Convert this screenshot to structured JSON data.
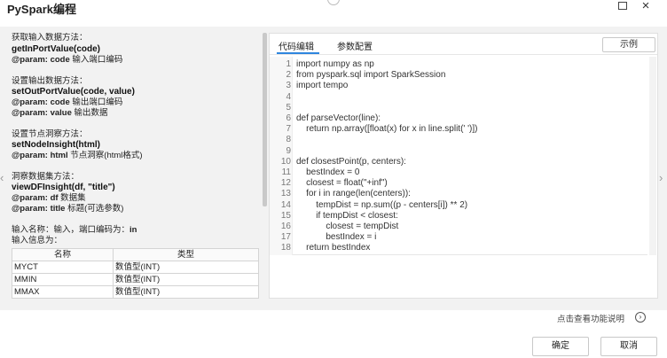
{
  "window": {
    "title": "PySpark编程",
    "minimize_icon": "square-icon",
    "close_label": "×"
  },
  "nav": {
    "left_arrow": "‹",
    "right_arrow": "›"
  },
  "help": {
    "lines": [
      {
        "kind": "text",
        "text": "获取输入数据方法："
      },
      {
        "kind": "fn",
        "text": "getInPortValue(code)"
      },
      {
        "kind": "param",
        "name": "@param: code",
        "desc": " 输入端口编码"
      },
      {
        "kind": "text",
        "text": "设置输出数据方法："
      },
      {
        "kind": "fn",
        "text": "setOutPortValue(code, value)"
      },
      {
        "kind": "param",
        "name": "@param: code",
        "desc": " 输出端口编码"
      },
      {
        "kind": "param",
        "name": "@param: value",
        "desc": " 输出数据"
      },
      {
        "kind": "text",
        "text": "设置节点洞察方法："
      },
      {
        "kind": "fn",
        "text": "setNodeInsight(html)"
      },
      {
        "kind": "param",
        "name": "@param: html",
        "desc": " 节点洞察(html格式)"
      },
      {
        "kind": "text",
        "text": "洞察数据集方法："
      },
      {
        "kind": "fn",
        "text": "viewDFInsight(df, \"title\")"
      },
      {
        "kind": "param",
        "name": "@param: df",
        "desc": " 数据集"
      },
      {
        "kind": "param",
        "name": "@param: title",
        "desc": " 标题(可选参数)"
      },
      {
        "kind": "port",
        "label": "输入名称：输入，端口编码为：",
        "code": "in"
      },
      {
        "kind": "text",
        "text": "输入信息为："
      }
    ],
    "table": {
      "headers": [
        "名称",
        "类型"
      ],
      "rows": [
        [
          "MYCT",
          "数值型(INT)"
        ],
        [
          "MMIN",
          "数值型(INT)"
        ],
        [
          "MMAX",
          "数值型(INT)"
        ]
      ]
    }
  },
  "editor": {
    "tabs": [
      "代码编辑",
      "参数配置"
    ],
    "example_label": "示例",
    "lines": [
      {
        "num": "1",
        "text": "import numpy as np"
      },
      {
        "num": "2",
        "text": "from pyspark.sql import SparkSession"
      },
      {
        "num": "3",
        "text": "import tempo"
      },
      {
        "num": "4",
        "text": ""
      },
      {
        "num": "5",
        "text": ""
      },
      {
        "num": "6",
        "text": "def parseVector(line):"
      },
      {
        "num": "7",
        "text": "    return np.array([float(x) for x in line.split(' ')])"
      },
      {
        "num": "8",
        "text": ""
      },
      {
        "num": "9",
        "text": ""
      },
      {
        "num": "10",
        "text": "def closestPoint(p, centers):"
      },
      {
        "num": "11",
        "text": "    bestIndex = 0"
      },
      {
        "num": "12",
        "text": "    closest = float(\"+inf\")"
      },
      {
        "num": "13",
        "text": "    for i in range(len(centers)):"
      },
      {
        "num": "14",
        "text": "        tempDist = np.sum((p - centers[i]) ** 2)"
      },
      {
        "num": "15",
        "text": "        if tempDist < closest:"
      },
      {
        "num": "16",
        "text": "            closest = tempDist"
      },
      {
        "num": "17",
        "text": "            bestIndex = i"
      },
      {
        "num": "18",
        "text": "    return bestIndex"
      }
    ]
  },
  "footer": {
    "help_link": "点击查看功能说明",
    "help_icon": "chevron-right-circle-icon",
    "ok_label": "确定",
    "cancel_label": "取消"
  },
  "colors": {
    "accent": "#2e86de"
  }
}
